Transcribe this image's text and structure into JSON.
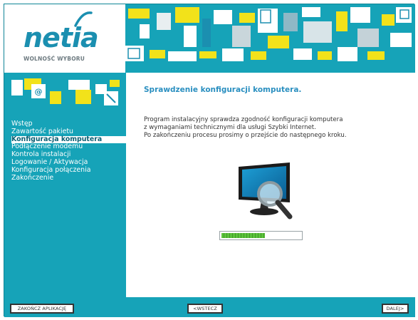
{
  "brand": {
    "logo_name": "netia",
    "tagline": "WOLNOŚĆ WYBORU"
  },
  "sidebar": {
    "items": [
      {
        "label": "Wstęp",
        "active": false
      },
      {
        "label": "Zawartość pakietu",
        "active": false
      },
      {
        "label": "Konfiguracja komputera",
        "active": true
      },
      {
        "label": "Podłączenie modemu",
        "active": false
      },
      {
        "label": "Kontrola instalacji",
        "active": false
      },
      {
        "label": "Logowanie / Aktywacja",
        "active": false
      },
      {
        "label": "Konfiguracja połączenia",
        "active": false
      },
      {
        "label": "Zakończenie",
        "active": false
      }
    ]
  },
  "main": {
    "title": "Sprawdzenie konfiguracji komputera.",
    "description": [
      "Program instalacyjny sprawdza zgodność konfiguracji komputera",
      "z wymaganiami technicznymi dla usługi Szybki Internet.",
      "Po zakończeniu procesu prosimy o przejście do następnego kroku."
    ],
    "progress_fraction": 0.55
  },
  "footer": {
    "finish_label": "ZAKOŃCZ APLIKACJĘ",
    "back_label": "<WSTECZ",
    "next_label": "DALEJ>"
  },
  "colors": {
    "teal": "#16a3b8",
    "title_blue": "#2a8fc0",
    "logo_blue": "#1b8fb0",
    "progress_green": "#5cc23c"
  }
}
